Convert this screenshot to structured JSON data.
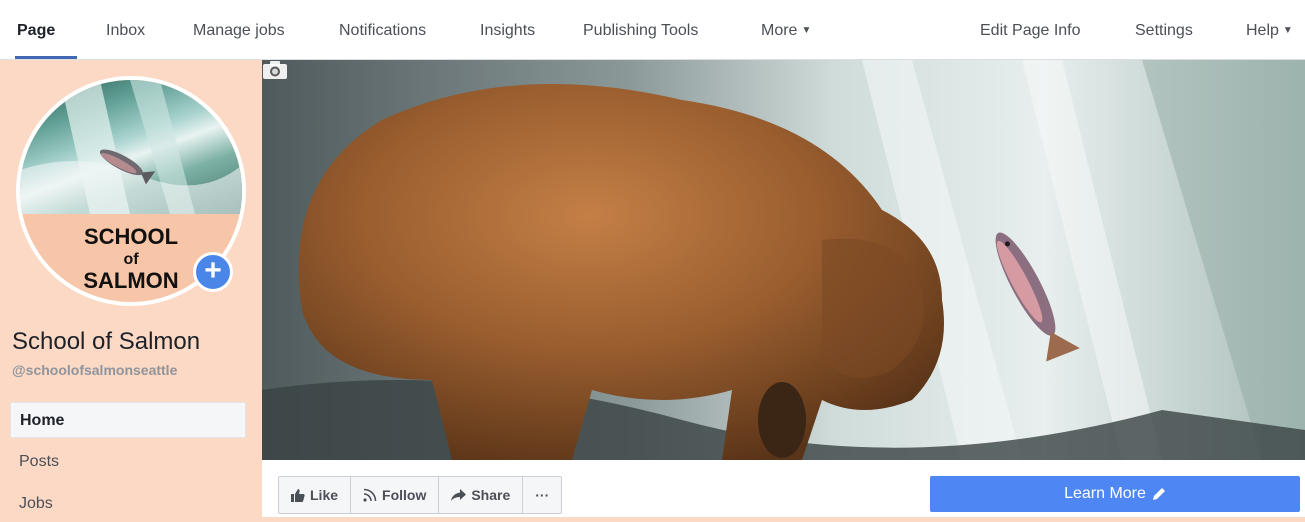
{
  "topnav": {
    "items": [
      {
        "label": "Page",
        "active": true
      },
      {
        "label": "Inbox"
      },
      {
        "label": "Manage jobs"
      },
      {
        "label": "Notifications"
      },
      {
        "label": "Insights"
      },
      {
        "label": "Publishing Tools"
      },
      {
        "label": "More"
      }
    ],
    "right_items": [
      {
        "label": "Edit Page Info"
      },
      {
        "label": "Settings"
      },
      {
        "label": "Help"
      }
    ]
  },
  "profile": {
    "logo_line1": "SCHOOL",
    "logo_line2": "of",
    "logo_line3": "SALMON",
    "add_icon": "+"
  },
  "page": {
    "name": "School of Salmon",
    "handle": "@schoolofsalmonseattle"
  },
  "sidebar": {
    "items": [
      {
        "label": "Home",
        "active": true
      },
      {
        "label": "Posts"
      },
      {
        "label": "Jobs"
      }
    ]
  },
  "actions": {
    "like": "Like",
    "follow": "Follow",
    "share": "Share",
    "more": "···",
    "learn_more": "Learn More"
  },
  "colors": {
    "background": "#fbd9c4",
    "accent": "#4e86f3",
    "nav_underline": "#4267b2"
  }
}
